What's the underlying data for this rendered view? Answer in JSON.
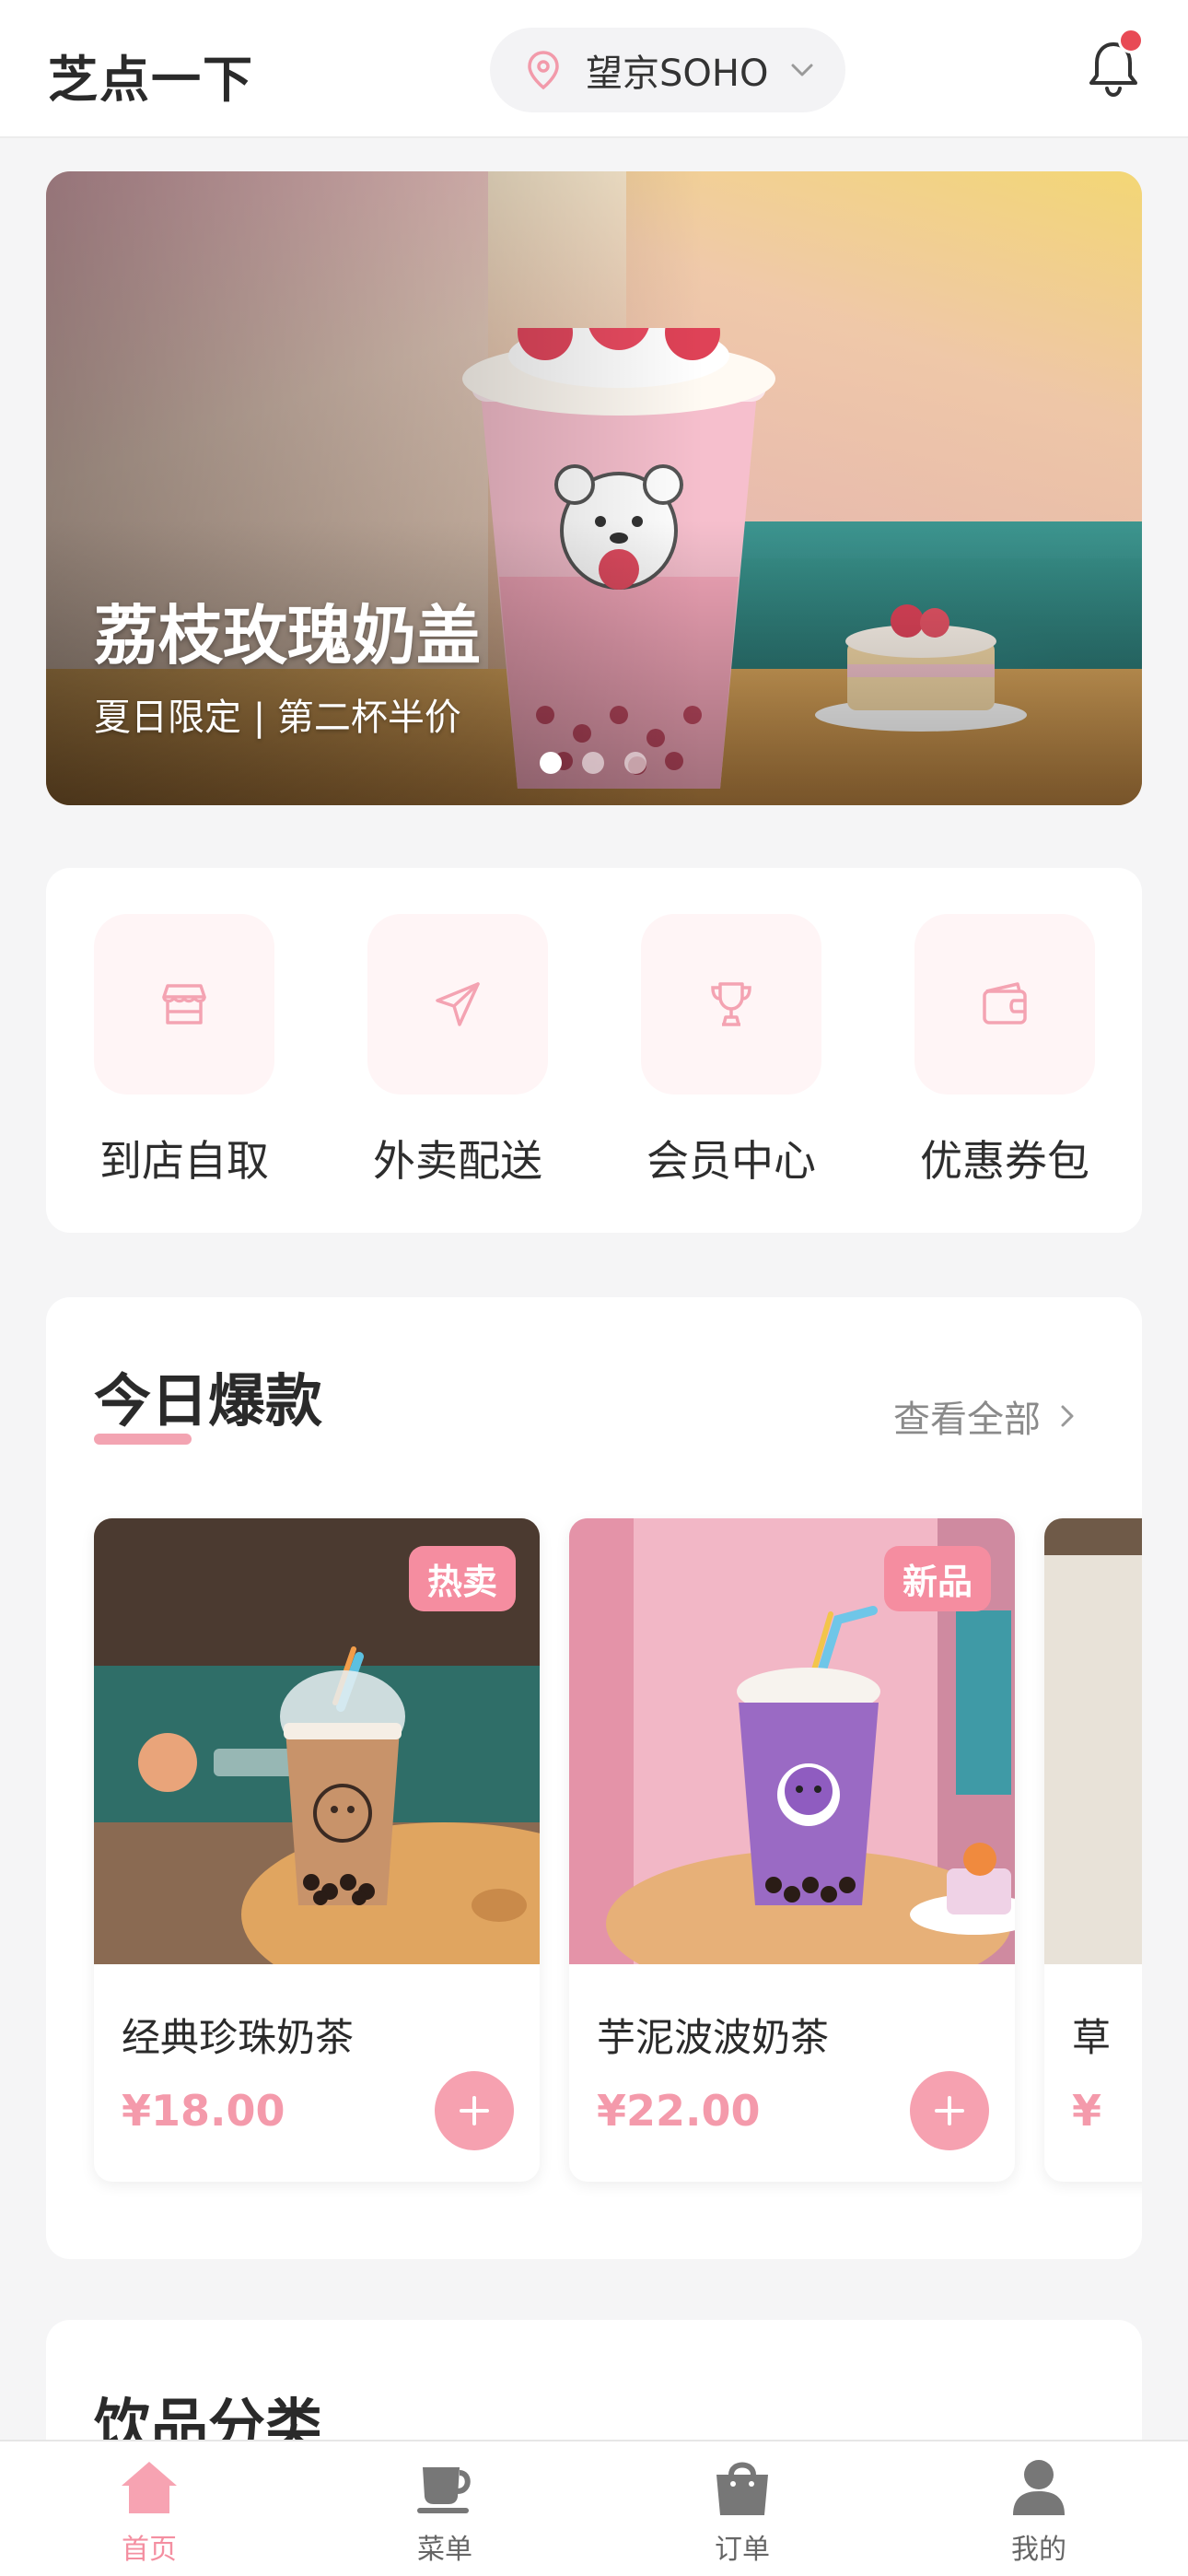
{
  "header": {
    "app_title": "芝点一下",
    "location": "望京SOHO",
    "icons": {
      "location": "map-pin-icon",
      "dropdown": "chevron-down-icon",
      "notifications": "bell-icon"
    }
  },
  "banner": {
    "title": "荔枝玫瑰奶盖",
    "subtitle": "夏日限定 | 第二杯半价",
    "slide_count": 3,
    "active_slide": 1
  },
  "services": [
    {
      "label": "到店自取",
      "icon": "store-icon"
    },
    {
      "label": "外卖配送",
      "icon": "send-icon"
    },
    {
      "label": "会员中心",
      "icon": "trophy-icon"
    },
    {
      "label": "优惠券包",
      "icon": "wallet-icon"
    }
  ],
  "hot": {
    "title": "今日爆款",
    "view_all": "查看全部",
    "products": [
      {
        "name": "经典珍珠奶茶",
        "price": "¥18.00",
        "badge": "热卖"
      },
      {
        "name": "芋泥波波奶茶",
        "price": "¥22.00",
        "badge": "新品"
      },
      {
        "name": "草",
        "price": "¥",
        "badge": ""
      }
    ]
  },
  "category": {
    "title": "饮品分类"
  },
  "tabbar": {
    "tabs": [
      {
        "label": "首页",
        "icon": "home-icon",
        "active": true
      },
      {
        "label": "菜单",
        "icon": "coffee-cup-icon",
        "active": false
      },
      {
        "label": "订单",
        "icon": "shopping-bag-icon",
        "active": false
      },
      {
        "label": "我的",
        "icon": "user-icon",
        "active": false
      }
    ]
  },
  "colors": {
    "accent": "#f48fa1",
    "background": "#f5f5f6",
    "badge": "#f58da0",
    "price": "#f49aab"
  }
}
